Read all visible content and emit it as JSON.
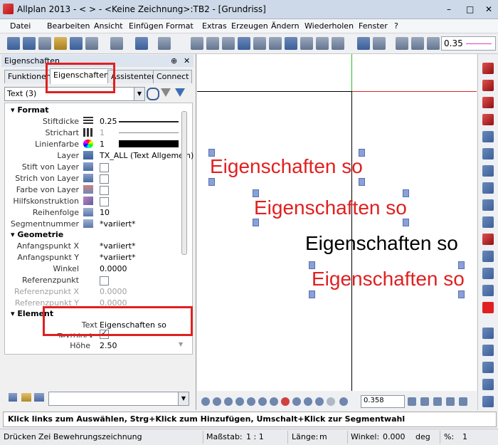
{
  "window": {
    "title": "Allplan 2013 -  <      > - <Keine Zeichnung>:TB2 - [Grundriss]",
    "minimize": "–",
    "maximize": "□",
    "close": "✕"
  },
  "menu": [
    "Datei",
    "Bearbeiten",
    "Ansicht",
    "Einfügen",
    "Format",
    "Extras",
    "Erzeugen",
    "Ändern",
    "Wiederholen",
    "Fenster",
    "?"
  ],
  "toolbar": {
    "pen_value": "0.35"
  },
  "panel": {
    "title": "Eigenschaften",
    "pin": "⊕",
    "close": "✕",
    "tabs": [
      "Funktionen",
      "Eigenschaften",
      "Assistenten",
      "Connect"
    ],
    "filter_value": "Text (3)",
    "sections": {
      "format": "Format",
      "geometrie": "Geometrie",
      "element": "Element"
    },
    "format_rows": {
      "stiftdicke_label": "Stiftdicke",
      "stiftdicke_value": "0.25",
      "strichart_label": "Strichart",
      "strichart_value": "1",
      "linienfarbe_label": "Linienfarbe",
      "linienfarbe_value": "1",
      "layer_label": "Layer",
      "layer_value": "TX_ALL (Text Allgemein)",
      "stift_layer_label": "Stift von Layer",
      "strich_layer_label": "Strich von Layer",
      "farbe_layer_label": "Farbe von Layer",
      "hilfs_label": "Hilfskonstruktion",
      "reihenfolge_label": "Reihenfolge",
      "reihenfolge_value": "10",
      "segment_label": "Segmentnummer",
      "segment_value": "*variiert*"
    },
    "geometrie_rows": {
      "apx_label": "Anfangspunkt X",
      "apx_value": "*variiert*",
      "apy_label": "Anfangspunkt Y",
      "apy_value": "*variiert*",
      "winkel_label": "Winkel",
      "winkel_value": "0.0000",
      "ref_label": "Referenzpunkt",
      "refx_label": "Referenzpunkt X",
      "refx_value": "0.0000",
      "refy_label": "Referenzpunkt Y",
      "refy_value": "0.0000"
    },
    "element_rows": {
      "text_label": "Text",
      "text_value": "Eigenschaften so",
      "textblock_label": "Textblock",
      "hoehe_label": "Höhe",
      "hoehe_value": "2.50"
    }
  },
  "canvas": {
    "texts": [
      "Eigenschaften so",
      "Eigenschaften so",
      "Eigenschaften so",
      "Eigenschaften so"
    ],
    "colors": {
      "selected": "#e02020",
      "normal": "#000000"
    }
  },
  "nav": {
    "zoom_value": "0.358"
  },
  "prompt": "Klick links zum Auswählen, Strg+Klick zum Hinzufügen, Umschalt+Klick zur Segmentwahl",
  "status": {
    "mode": "Drücken",
    "drawing": "Zei Bewehrungszeichnung",
    "scale_label": "Maßstab:",
    "scale_value": "1 : 1",
    "length_label": "Länge:",
    "length_value": "m",
    "angle_label": "Winkel:",
    "angle_value": "0.000",
    "angle_unit": "deg",
    "percent_label": "%:",
    "percent_value": "1"
  }
}
